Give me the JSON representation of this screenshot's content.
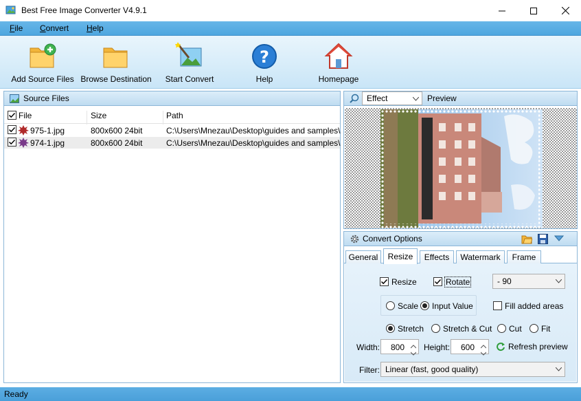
{
  "window": {
    "title": "Best Free Image Converter V4.9.1"
  },
  "menu": [
    {
      "label": "File",
      "u": "F",
      "rest": "ile"
    },
    {
      "label": "Convert",
      "u": "C",
      "rest": "onvert"
    },
    {
      "label": "Help",
      "u": "H",
      "rest": "elp"
    }
  ],
  "toolbar": {
    "add_source": "Add Source Files",
    "browse_dest": "Browse Destination",
    "start_convert": "Start Convert",
    "help": "Help",
    "homepage": "Homepage"
  },
  "source": {
    "title": "Source Files",
    "columns": {
      "file": "File",
      "size": "Size",
      "path": "Path"
    },
    "rows": [
      {
        "file": "975-1.jpg",
        "size": "800x600  24bit",
        "path": "C:\\Users\\Mnezau\\Desktop\\guides and samples\\",
        "checked": true
      },
      {
        "file": "974-1.jpg",
        "size": "800x600  24bit",
        "path": "C:\\Users\\Mnezau\\Desktop\\guides and samples\\",
        "checked": true
      }
    ]
  },
  "preview": {
    "mode_value": "Effect",
    "label": "Preview"
  },
  "options": {
    "title": "Convert Options",
    "tabs": [
      "General",
      "Resize",
      "Effects",
      "Watermark",
      "Frame"
    ],
    "active_tab": "Resize",
    "resize_label": "Resize",
    "rotate_label": "Rotate",
    "rotate_value": "- 90",
    "scale_label": "Scale",
    "input_value_label": "Input Value",
    "fill_label": "Fill added areas",
    "stretch_label": "Stretch",
    "stretch_cut_label": "Stretch & Cut",
    "cut_label": "Cut",
    "fit_label": "Fit",
    "width_label": "Width:",
    "width_value": "800",
    "height_label": "Height:",
    "height_value": "600",
    "refresh_label": "Refresh preview",
    "filter_label": "Filter:",
    "filter_value": "Linear (fast, good quality)"
  },
  "status": {
    "text": "Ready"
  }
}
